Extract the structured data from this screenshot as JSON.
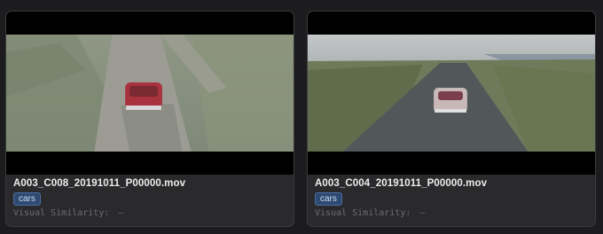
{
  "clips": [
    {
      "filename": "A003_C008_20191011_P00000.mov",
      "tag": "cars",
      "similarity_label": "Visual Similarity:",
      "similarity_value": "–",
      "thumbnail": "aerial shot of a red classic convertible driving on a dirt road"
    },
    {
      "filename": "A003_C004_20191011_P00000.mov",
      "tag": "cars",
      "similarity_label": "Visual Similarity:",
      "similarity_value": "–",
      "thumbnail": "aerial shot of a classic convertible driving on a coastal road"
    }
  ],
  "colors": {
    "background": "#1c1c1e",
    "card": "#2a2a2c",
    "tag_bg": "#2f4a70",
    "tag_text": "#c9dcf6",
    "muted_text": "#6e6e72"
  }
}
